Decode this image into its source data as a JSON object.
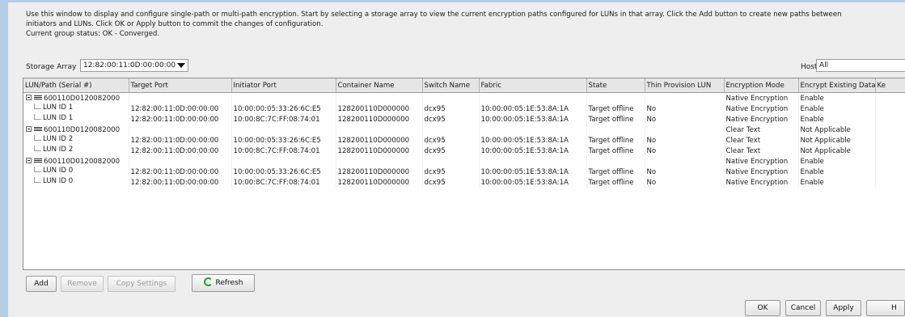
{
  "intro": {
    "line1": "Use this window to display and configure single-path or multi-path encryption. Start by selecting a storage array to view the current encryption paths configured for LUNs in that array. Click the Add button to create new paths between",
    "line2": "initiators and LUNs. Click OK or Apply button to commit the changes of configuration.",
    "line3": "Current group status: OK - Converged."
  },
  "storage_array": {
    "label": "Storage Array",
    "value": "12:82:00:11:0D:00:00:00"
  },
  "host": {
    "label": "Host",
    "value": "All"
  },
  "table": {
    "columns": [
      "LUN/Path (Serial #)",
      "Target Port",
      "Initiator Port",
      "Container Name",
      "Switch Name",
      "Fabric",
      "State",
      "Thin Provision LUN",
      "Encryption Mode",
      "Encrypt Existing Data",
      "Ke"
    ],
    "rows": [
      {
        "kind": "group",
        "cells": [
          "600110D0120082000",
          "",
          "",
          "",
          "",
          "",
          "",
          "",
          "Native Encryption",
          "Enable",
          ""
        ]
      },
      {
        "kind": "leaf",
        "cells": [
          "LUN ID 1",
          "12:82:00:11:0D:00:00:00",
          "10:00:00:05:33:26:6C:E5",
          "128200110D000000",
          "dcx95",
          "10:00:00:05:1E:53:8A:1A",
          "Target offline",
          "No",
          "Native Encryption",
          "Enable",
          ""
        ]
      },
      {
        "kind": "leaf",
        "cells": [
          "LUN ID 1",
          "12:82:00:11:0D:00:00:00",
          "10:00:8C:7C:FF:08:74:01",
          "128200110D000000",
          "dcx95",
          "10:00:00:05:1E:53:8A:1A",
          "Target offline",
          "No",
          "Native Encryption",
          "Enable",
          ""
        ]
      },
      {
        "kind": "group",
        "cells": [
          "600110D0120082000",
          "",
          "",
          "",
          "",
          "",
          "",
          "",
          "Clear Text",
          "Not Applicable",
          ""
        ]
      },
      {
        "kind": "leaf",
        "cells": [
          "LUN ID 2",
          "12:82:00:11:0D:00:00:00",
          "10:00:00:05:33:26:6C:E5",
          "128200110D000000",
          "dcx95",
          "10:00:00:05:1E:53:8A:1A",
          "Target offline",
          "No",
          "Clear Text",
          "Not Applicable",
          ""
        ]
      },
      {
        "kind": "leaf",
        "cells": [
          "LUN ID 2",
          "12:82:00:11:0D:00:00:00",
          "10:00:8C:7C:FF:08:74:01",
          "128200110D000000",
          "dcx95",
          "10:00:00:05:1E:53:8A:1A",
          "Target offline",
          "No",
          "Clear Text",
          "Not Applicable",
          ""
        ]
      },
      {
        "kind": "group",
        "cells": [
          "600110D0120082000",
          "",
          "",
          "",
          "",
          "",
          "",
          "",
          "Native Encryption",
          "Enable",
          ""
        ]
      },
      {
        "kind": "leaf",
        "cells": [
          "LUN ID 0",
          "12:82:00:11:0D:00:00:00",
          "10:00:00:05:33:26:6C:E5",
          "128200110D000000",
          "dcx95",
          "10:00:00:05:1E:53:8A:1A",
          "Target offline",
          "No",
          "Native Encryption",
          "Enable",
          ""
        ]
      },
      {
        "kind": "leaf",
        "cells": [
          "LUN ID 0",
          "12:82:00:11:0D:00:00:00",
          "10:00:8C:7C:FF:08:74:01",
          "128200110D000000",
          "dcx95",
          "10:00:00:05:1E:53:8A:1A",
          "Target offline",
          "No",
          "Native Encryption",
          "Enable",
          ""
        ]
      }
    ]
  },
  "buttons": {
    "add": "Add",
    "remove": "Remove",
    "copy_settings": "Copy Settings",
    "refresh": "Refresh",
    "ok": "OK",
    "cancel": "Cancel",
    "apply": "Apply",
    "partial": "H"
  },
  "icons": {
    "expander": "collapse-minus-icon",
    "lun_group": "lun-group-icon",
    "refresh": "refresh-icon",
    "dropdown": "chevron-down-icon",
    "editable_marker": "editable-corner-icon"
  },
  "colors": {
    "marker_green": "#2da12d",
    "window_edge": "#b6cde6"
  }
}
